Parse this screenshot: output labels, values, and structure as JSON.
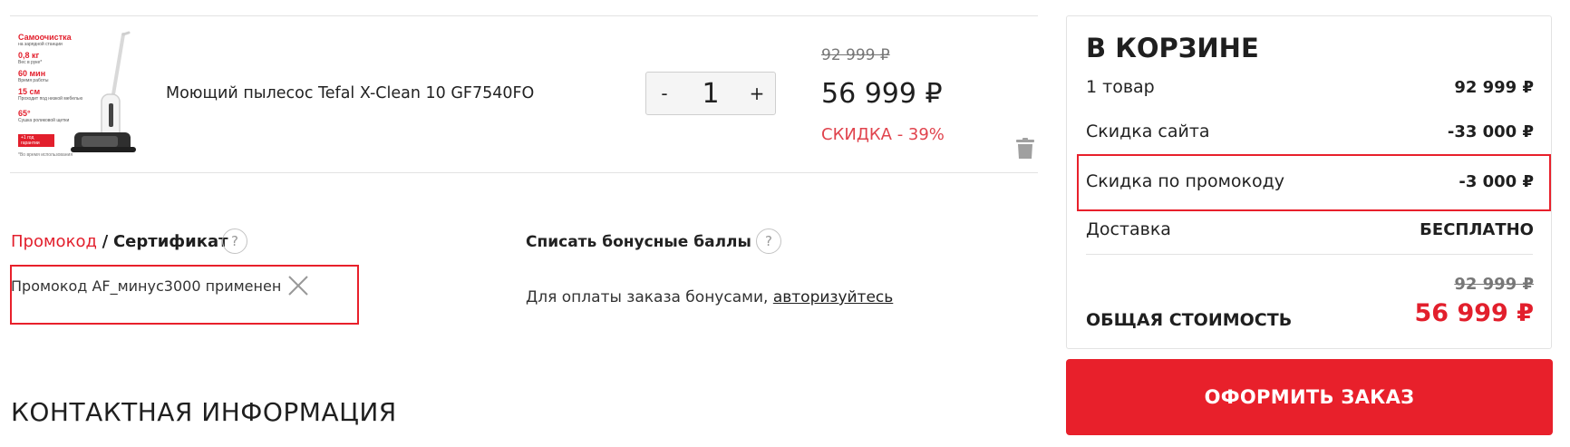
{
  "product": {
    "name": "Моющий пылесос Tefal X-Clean 10 GF7540FO",
    "thumbnail_specs": [
      {
        "big": "Самоочистка",
        "small": "на зарядной станции"
      },
      {
        "big": "0,8 кг",
        "small": "Вес в руке*"
      },
      {
        "big": "60 мин",
        "small": "Время работы"
      },
      {
        "big": "15 см",
        "small": "Проходит под низкой мебелью"
      },
      {
        "big": "65°",
        "small": "Сушка роликовой щетки"
      }
    ],
    "thumbnail_badge": "+1 год гарантии",
    "thumbnail_footnote": "*Во время использования",
    "quantity": "1",
    "minus_label": "-",
    "plus_label": "+",
    "old_price": "92 999 ₽",
    "price": "56 999 ₽",
    "discount": "СКИДКА - 39%",
    "icons": {
      "delete": "trash-icon"
    }
  },
  "promo": {
    "tab_promo": "Промокод",
    "separator": "/",
    "tab_certificate": "Сертификат",
    "help_label": "?",
    "applied_text": "Промокод AF_минус3000 применен",
    "remove_icon": "close-icon"
  },
  "bonus": {
    "title": "Списать бонусные баллы",
    "help_label": "?",
    "text": "Для оплаты заказа бонусами,",
    "link": "авторизуйтесь"
  },
  "contact": {
    "title": "КОНТАКТНАЯ ИНФОРМАЦИЯ"
  },
  "summary": {
    "title": "В КОРЗИНЕ",
    "rows": [
      {
        "label": "1 товар",
        "value": "92 999 ₽"
      },
      {
        "label": "Скидка сайта",
        "value": "-33 000 ₽"
      },
      {
        "label": "Скидка по промокоду",
        "value": "-3 000 ₽"
      },
      {
        "label": "Доставка",
        "value": "БЕСПЛАТНО"
      }
    ],
    "old_total": "92 999 ₽",
    "total_label": "ОБЩАЯ СТОИМОСТЬ",
    "total": "56 999 ₽"
  },
  "checkout_label": "ОФОРМИТЬ ЗАКАЗ",
  "colors": {
    "accent": "#e8202b",
    "discount_text": "#e0434d",
    "text": "#1f1f1f"
  }
}
